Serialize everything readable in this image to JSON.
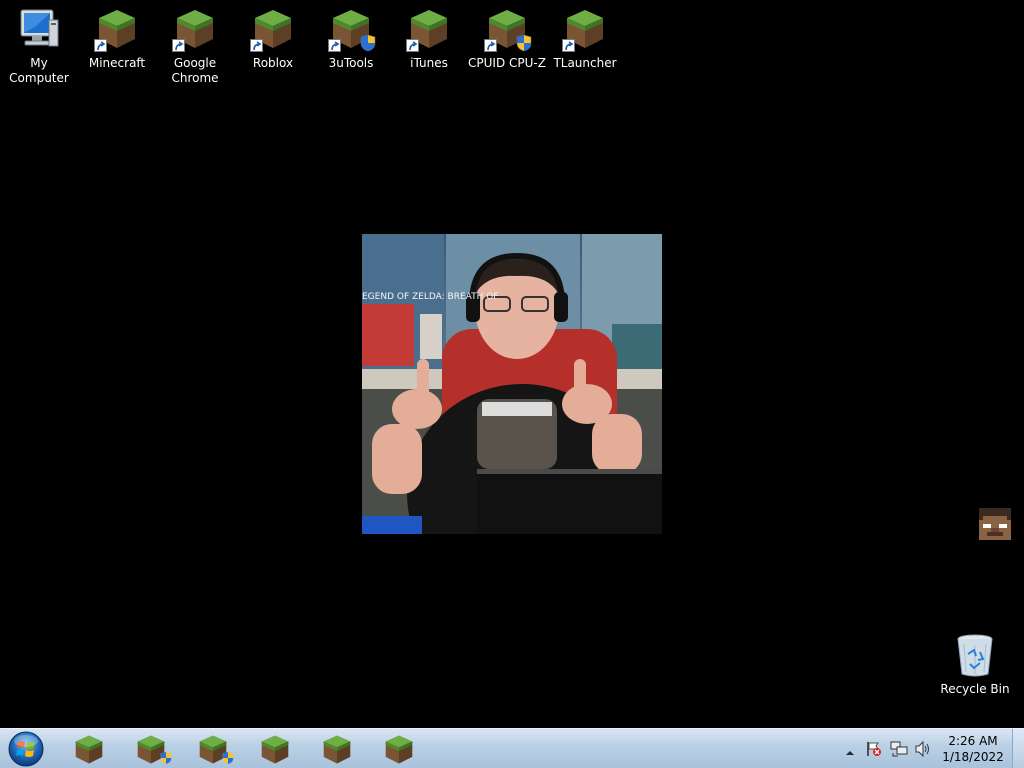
{
  "desktop": {
    "icons": [
      {
        "label": "My Computer",
        "icon": "computer-icon"
      },
      {
        "label": "Minecraft",
        "icon": "minecraft-icon"
      },
      {
        "label": "Google Chrome",
        "icon": "minecraft-icon"
      },
      {
        "label": "Roblox",
        "icon": "minecraft-icon"
      },
      {
        "label": "3uTools",
        "icon": "minecraft-icon"
      },
      {
        "label": "iTunes",
        "icon": "minecraft-icon"
      },
      {
        "label": "CPUID CPU-Z",
        "icon": "minecraft-icon"
      },
      {
        "label": "TLauncher",
        "icon": "minecraft-icon"
      }
    ],
    "recycle_bin": {
      "label": "Recycle Bin",
      "icon": "recycle-bin-icon"
    },
    "wallpaper": {
      "text": "EGEND OF ZELDA: BREATH OF",
      "icon": "wallpaper-photo"
    }
  },
  "taskbar": {
    "start": {
      "icon": "windows-start-orb"
    },
    "pinned": [
      {
        "icon": "minecraft-icon"
      },
      {
        "icon": "minecraft-icon"
      },
      {
        "icon": "minecraft-icon"
      },
      {
        "icon": "minecraft-icon"
      },
      {
        "icon": "minecraft-icon"
      },
      {
        "icon": "minecraft-icon"
      }
    ],
    "tray": {
      "icons": [
        "show-hidden-icons-arrow",
        "action-center-flag-icon",
        "network-icon",
        "volume-icon"
      ],
      "time": "2:26 AM",
      "date": "1/18/2022"
    }
  },
  "colors": {
    "desktop_bg": "#000000",
    "taskbar": "#b9cfe4",
    "grass_top": "#5f9e3a",
    "dirt": "#7a5533"
  }
}
